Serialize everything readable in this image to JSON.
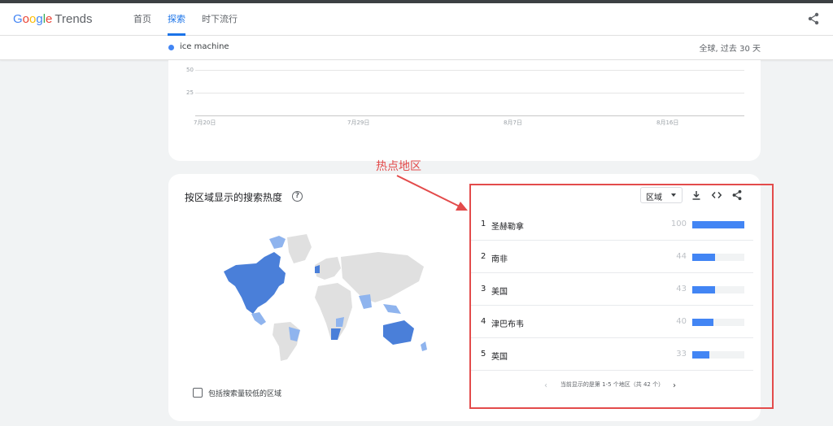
{
  "header": {
    "logo_google": [
      "G",
      "o",
      "o",
      "g",
      "l",
      "e"
    ],
    "logo_trends": "Trends",
    "nav": [
      {
        "label": "首页",
        "active": false
      },
      {
        "label": "探索",
        "active": true
      },
      {
        "label": "时下流行",
        "active": false
      }
    ]
  },
  "subbar": {
    "term": "ice machine",
    "term_color": "#4285f4",
    "range": "全球, 过去 30 天"
  },
  "timeline": {
    "y_ticks": [
      "50",
      "25"
    ],
    "x_ticks": [
      "7月20日",
      "7月29日",
      "8月7日",
      "8月16日"
    ]
  },
  "region_card": {
    "title": "按区域显示的搜索热度",
    "help_icon": "?",
    "include_low_label": "包括搜索量较低的区域",
    "resolution_select": "区域",
    "toolbar_icons": [
      "download-icon",
      "embed-icon",
      "share-icon"
    ],
    "rows": [
      {
        "rank": "1",
        "name": "圣赫勒拿",
        "value": 100
      },
      {
        "rank": "2",
        "name": "南非",
        "value": 44
      },
      {
        "rank": "3",
        "name": "美国",
        "value": 43
      },
      {
        "rank": "4",
        "name": "津巴布韦",
        "value": 40
      },
      {
        "rank": "5",
        "name": "英国",
        "value": 33
      }
    ],
    "pager_text": "当前显示的是第 1-5 个地区（共 42 个）",
    "pager_prev": "‹",
    "pager_next": "›"
  },
  "annotation": {
    "label": "热点地区",
    "color": "#e34b4b"
  },
  "colors": {
    "accent": "#1a73e8",
    "bar": "#4285f4",
    "map_high": "#4a7fd9",
    "map_mid": "#8fb4ee",
    "map_none": "#e0e0e0"
  }
}
